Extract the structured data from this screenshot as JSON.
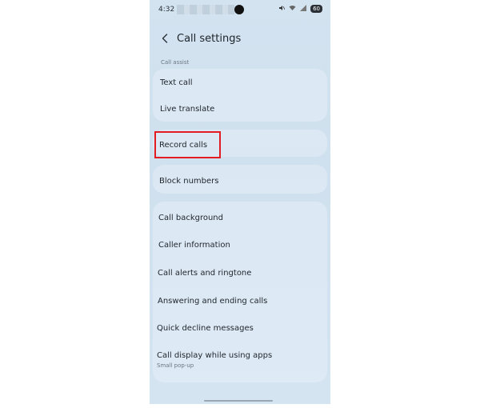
{
  "status_bar": {
    "time": "4:32",
    "battery": "60"
  },
  "header": {
    "title": "Call settings"
  },
  "section": {
    "label": "Call assist"
  },
  "items": [
    {
      "label": "Text call"
    },
    {
      "label": "Live translate"
    },
    {
      "label": "Record calls"
    },
    {
      "label": "Block numbers"
    },
    {
      "label": "Call background"
    },
    {
      "label": "Caller information"
    },
    {
      "label": "Call alerts and ringtone"
    },
    {
      "label": "Answering and ending calls"
    },
    {
      "label": "Quick decline messages"
    },
    {
      "label": "Call display while using apps",
      "subtitle": "Small pop-up"
    }
  ],
  "colors": {
    "highlight": "#e31b23",
    "background": "#d3e3f0"
  }
}
